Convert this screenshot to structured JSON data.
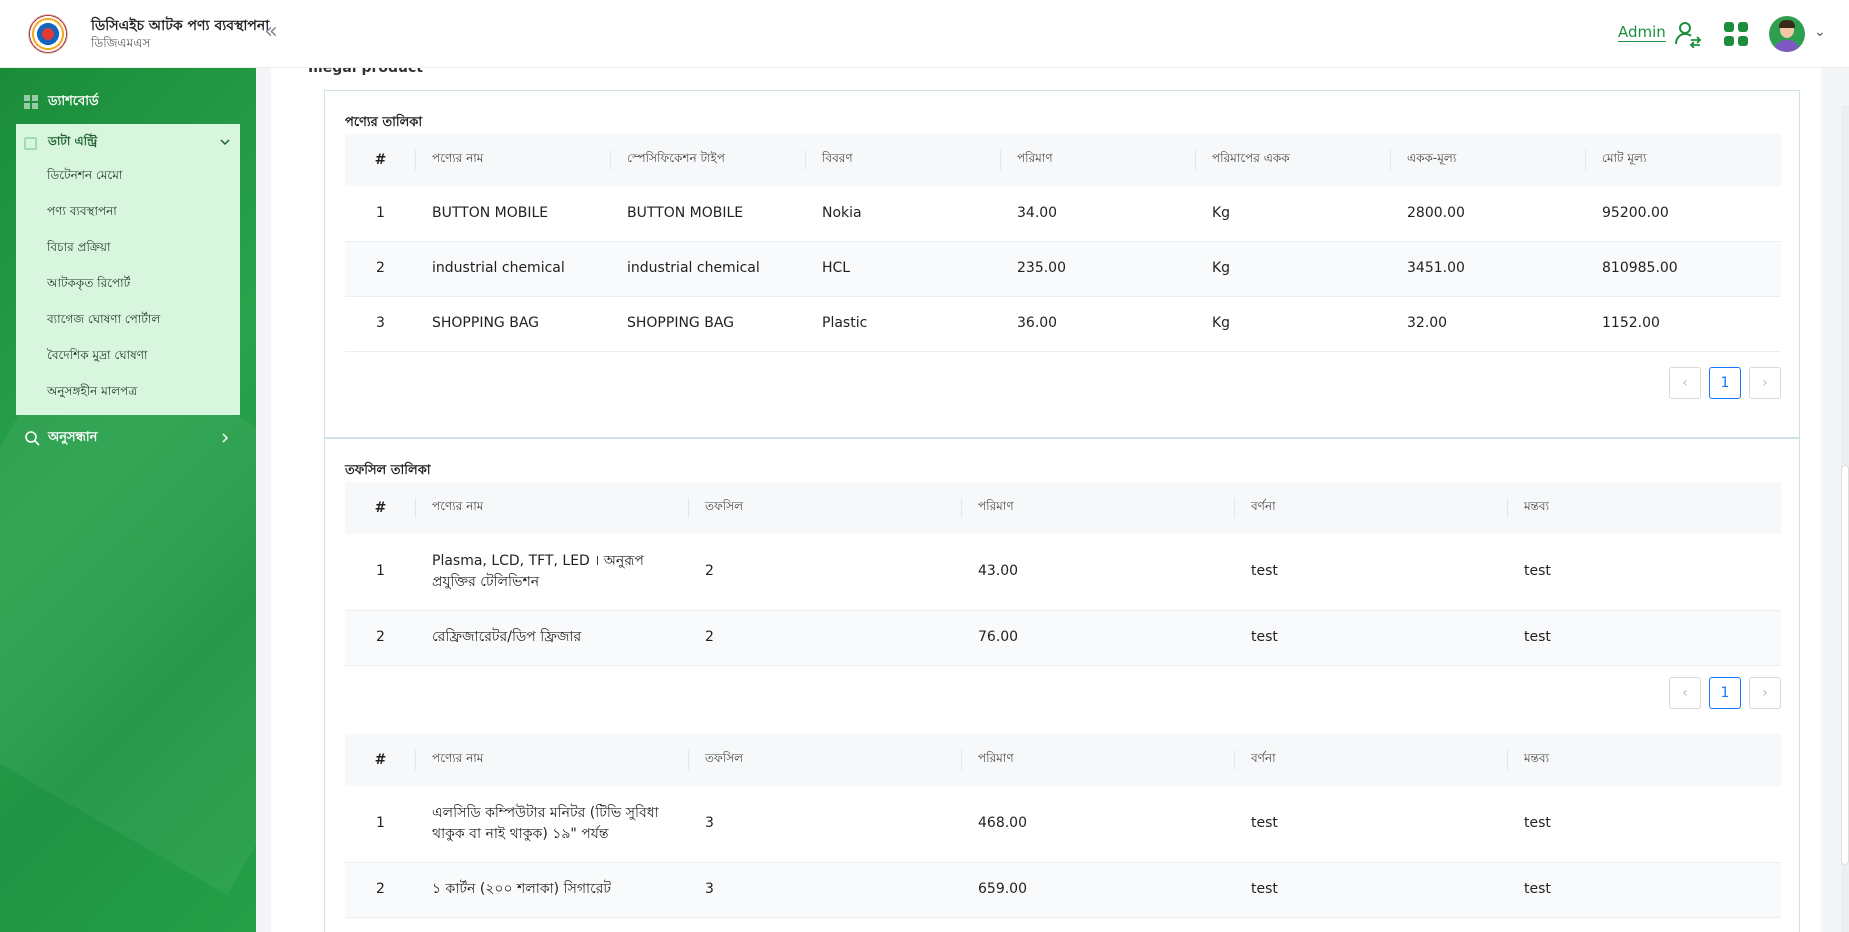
{
  "header": {
    "app_title": "ডিসিএইচ আটক পণ্য ব্যবস্থাপনা",
    "app_subtitle": "ডিজিএমএস",
    "collapse_glyph": "«",
    "admin_label": "Admin"
  },
  "sidebar": {
    "dashboard_label": "ড্যাশবোর্ড",
    "data_entry_label": "ডাটা এন্ট্রি",
    "submenu_items": [
      "ডিটেনশন মেমো",
      "পণ্য ব্যবস্থাপনা",
      "বিচার প্রক্রিয়া",
      "আটককৃত রিপোর্ট",
      "ব্যাগেজ ঘোষণা পোর্টাল",
      "বৈদেশিক মুদ্রা ঘোষণা",
      "অনুসঙ্গহীন মালপত্র"
    ],
    "search_label": "অনুসন্ধান"
  },
  "main": {
    "cut_title": "Illegal product",
    "product_table": {
      "title": "পণ্যের তালিকা",
      "columns": [
        "#",
        "পণ্যের নাম",
        "স্পেসিফিকেশন টাইপ",
        "বিবরণ",
        "পরিমাণ",
        "পরিমাপের একক",
        "একক-মূল্য",
        "মোট মূল্য"
      ],
      "rows": [
        [
          "1",
          "BUTTON MOBILE",
          "BUTTON MOBILE",
          "Nokia",
          "34.00",
          "Kg",
          "2800.00",
          "95200.00"
        ],
        [
          "2",
          "industrial chemical",
          "industrial chemical",
          "HCL",
          "235.00",
          "Kg",
          "3451.00",
          "810985.00"
        ],
        [
          "3",
          "SHOPPING BAG",
          "SHOPPING BAG",
          "Plastic",
          "36.00",
          "Kg",
          "32.00",
          "1152.00"
        ]
      ],
      "pager": {
        "prev": "‹",
        "page": "1",
        "next": "›"
      }
    },
    "detail_table": {
      "title": "তফসিল তালিকা",
      "columns": [
        "#",
        "পণ্যের নাম",
        "তফসিল",
        "পরিমাণ",
        "বর্ণনা",
        "মন্তব্য"
      ],
      "rows": [
        [
          "1",
          "Plasma, LCD, TFT, LED । অনুরূপ প্রযুক্তির টেলিভিশন",
          "2",
          "43.00",
          "test",
          "test"
        ],
        [
          "2",
          "রেফ্রিজারেটর/ডিপ ফ্রিজার",
          "2",
          "76.00",
          "test",
          "test"
        ]
      ],
      "pager": {
        "prev": "‹",
        "page": "1",
        "next": "›"
      }
    },
    "detail_table_2": {
      "columns": [
        "#",
        "পণ্যের নাম",
        "তফসিল",
        "পরিমাণ",
        "বর্ণনা",
        "মন্তব্য"
      ],
      "rows": [
        [
          "1",
          "এলসিডি কম্পিউটার মনিটর (টিভি সুবিধা থাকুক বা নাই থাকুক) ১৯\" পর্যন্ত",
          "3",
          "468.00",
          "test",
          "test"
        ],
        [
          "2",
          "১ কার্টন (২০০ শলাকা) সিগারেট",
          "3",
          "659.00",
          "test",
          "test"
        ]
      ]
    }
  },
  "icons": {
    "logo": "dcd-emblem-icon",
    "user_switch": "user-switch-icon",
    "apps": "apps-grid-icon",
    "avatar": "user-avatar",
    "search": "search-icon"
  },
  "colors": {
    "brand_green": "#1e8e3e",
    "sidebar_green": "#25a048",
    "submenu_bg": "#d8f5de",
    "pager_active": "#1677ff"
  }
}
